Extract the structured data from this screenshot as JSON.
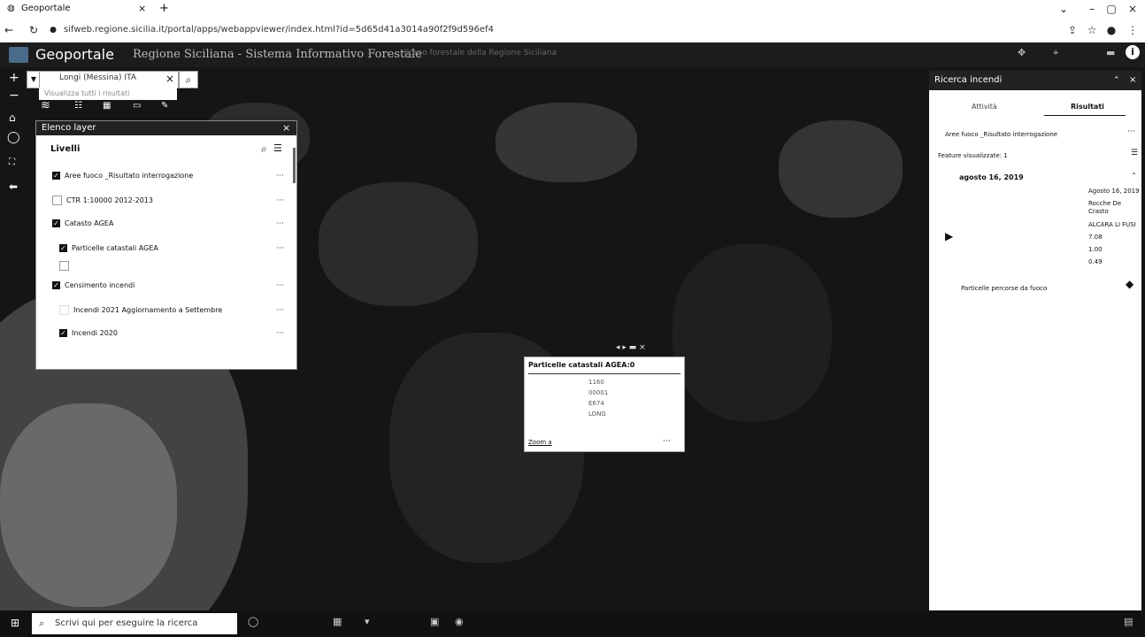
{
  "browser": {
    "tab_title": "Geoportale",
    "url": "sifweb.regione.sicilia.it/portal/apps/webappviewer/index.html?id=5d65d41a3014a90f2f9d596ef4"
  },
  "app": {
    "name": "Geoportale",
    "subtitle": "Regione Siciliana - Sistema Informativo Forestale",
    "faded_text": "Corpo forestale della Regione Siciliana"
  },
  "search": {
    "value": "Longi (Messina) ITA",
    "suggestion": "Visualizza tutti i risultati"
  },
  "layer_panel": {
    "title": "Elenco layer",
    "section": "Livelli",
    "rows": [
      {
        "label": "Aree fuoco _Risultato interrogazione",
        "checked": true
      },
      {
        "label": "CTR 1:10000 2012-2013",
        "checked": false
      },
      {
        "label": "Catasto AGEA",
        "checked": true
      },
      {
        "label": "Particelle catastali AGEA",
        "checked": true
      },
      {
        "label": "",
        "checked": false
      },
      {
        "label": "Censimento incendi",
        "checked": true
      },
      {
        "label": "Incendi 2021 Aggiornamento a Settembre",
        "checked": false
      },
      {
        "label": "Incendi 2020",
        "checked": true
      }
    ],
    "more": "···"
  },
  "popup": {
    "title": "Particelle catastali AGEA:0",
    "values": [
      "1160",
      "00001",
      "E674",
      "LONG"
    ],
    "zoom_link": "Zoom a",
    "more": "···"
  },
  "right_panel": {
    "title": "Ricerca incendi",
    "tabs": [
      "Attività",
      "Risultati"
    ],
    "layer_line": "Aree fuoco _Risultato interrogazione",
    "features_line": "Feature visualizzate: 1",
    "date_header": "agosto 16, 2019",
    "values": [
      "Agosto 16, 2019",
      "Rocche De Crasto",
      "ALCARA LI FUSI",
      "7.08",
      "1.00",
      "0.49"
    ],
    "footer_label": "Particelle percorse da fuoco"
  },
  "taskbar": {
    "search_placeholder": "Scrivi qui per eseguire la ricerca"
  },
  "colors": {
    "map_dark": "#151515",
    "panel_header": "#222222",
    "accent_tab_underline": "#111111"
  }
}
